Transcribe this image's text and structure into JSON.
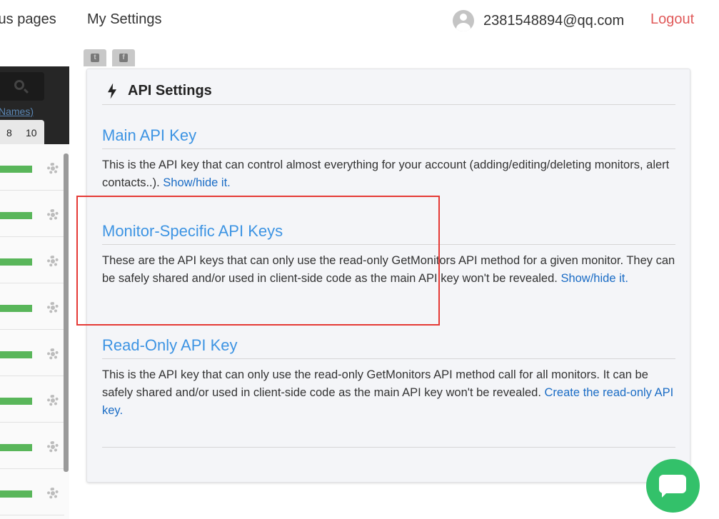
{
  "nav": {
    "status_pages": "tus pages",
    "my_settings": "My Settings",
    "user_email": "2381548894@qq.com",
    "logout": "Logout"
  },
  "social": {
    "twitter_icon": "twitter-icon",
    "facebook_icon": "facebook-icon"
  },
  "sidebar": {
    "names_link": "Names)",
    "pages": [
      "8",
      "10"
    ],
    "monitor_status_color": "#59b65a"
  },
  "panel": {
    "title": "API Settings",
    "title_icon": "bolt-icon",
    "sections": [
      {
        "title": "Main API Key",
        "text": "This is the API key that can control almost everything for your account (adding/editing/deleting monitors, alert contacts..). ",
        "link": "Show/hide it."
      },
      {
        "title": "Monitor-Specific API Keys",
        "text": "These are the API keys that can only use the read-only GetMonitors API method for a given monitor. They can be safely shared and/or used in client-side code as the main API key won't be revealed. ",
        "link": "Show/hide it."
      },
      {
        "title": "Read-Only API Key",
        "text": "This is the API key that can only use the read-only GetMonitors API method call for all monitors. It can be safely shared and/or used in client-side code as the main API key won't be revealed. ",
        "link": "Create the read-only API key."
      }
    ]
  },
  "colors": {
    "accent": "#3d94e3",
    "link": "#1a6cc5",
    "logout": "#e05a5a",
    "highlight": "#e53935",
    "chat": "#33c16a"
  }
}
